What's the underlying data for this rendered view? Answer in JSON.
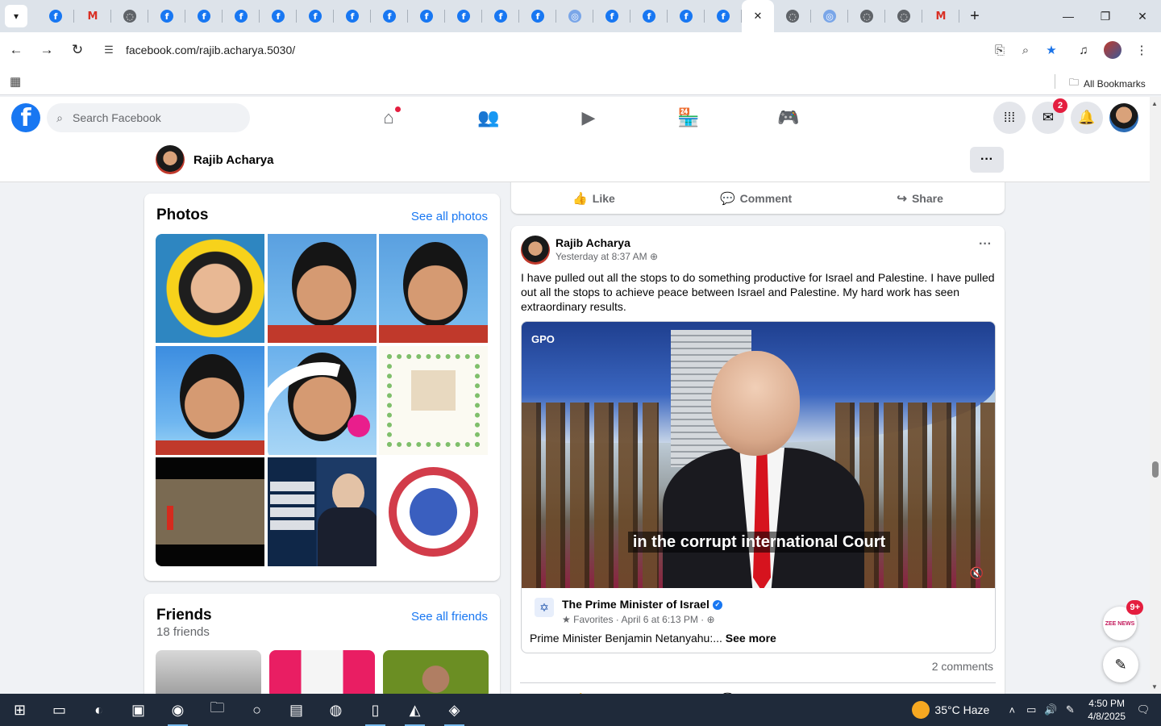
{
  "browser": {
    "url": "facebook.com/rajib.acharya.5030/",
    "bookmarks_label": "All Bookmarks",
    "tabs": [
      "fb",
      "gm",
      "globe",
      "fb",
      "fb",
      "fb",
      "fb",
      "fb",
      "fb",
      "fb",
      "fb",
      "fb",
      "fb",
      "fb",
      "un",
      "fb",
      "fb",
      "fb",
      "fb",
      "active",
      "globe",
      "un",
      "globe",
      "globe",
      "gm"
    ]
  },
  "fb": {
    "search_placeholder": "Search Facebook",
    "messenger_badge": "2",
    "profile_name": "Rajib Acharya"
  },
  "photos": {
    "title": "Photos",
    "see_all": "See all photos"
  },
  "friends": {
    "title": "Friends",
    "count": "18 friends",
    "see_all": "See all friends"
  },
  "actions": {
    "like": "Like",
    "comment": "Comment",
    "share": "Share"
  },
  "post": {
    "author": "Rajib Acharya",
    "time": "Yesterday at 8:37 AM",
    "text": "I have pulled out all the stops to do something productive for Israel and Palestine. I have pulled out all the stops to achieve peace between Israel and Palestine. My hard work has seen extraordinary results.",
    "video_caption": "in the corrupt international Court",
    "video_watermark": "GPO",
    "shared_source": "The Prime Minister of Israel",
    "shared_meta": "Favorites · April 6 at 6:13 PM ·",
    "shared_text": "Prime Minister Benjamin Netanyahu:...",
    "see_more": "See more",
    "comments": "2 comments"
  },
  "widgets": {
    "zee_badge": "9+",
    "zee_label": "ZEE NEWS"
  },
  "taskbar": {
    "weather": "35°C  Haze",
    "time": "4:50 PM",
    "date": "4/8/2025"
  }
}
